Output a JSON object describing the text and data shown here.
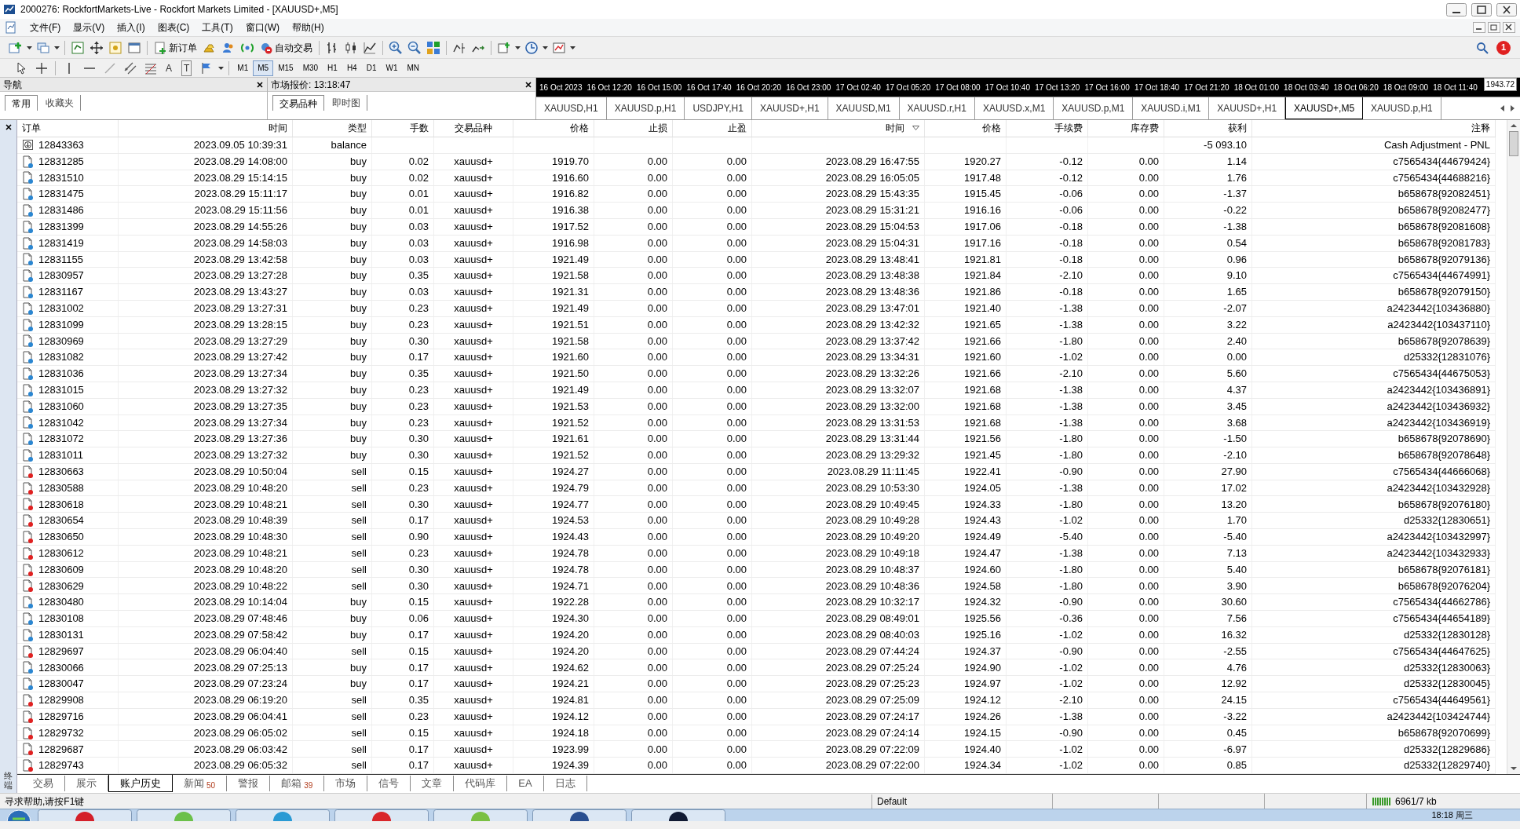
{
  "window": {
    "title": "2000276: RockfortMarkets-Live - Rockfort Markets Limited - [XAUUSD+,M5]"
  },
  "menu": [
    "文件(F)",
    "显示(V)",
    "插入(I)",
    "图表(C)",
    "工具(T)",
    "窗口(W)",
    "帮助(H)"
  ],
  "toolbar": {
    "new_order": "新订单",
    "auto_trading": "自动交易",
    "notifications": "1"
  },
  "drawing_toolbar": {
    "text_tool": "A",
    "text_label_tool": "T",
    "timeframes": [
      {
        "label": "M1",
        "selected": false
      },
      {
        "label": "M5",
        "selected": true
      },
      {
        "label": "M15",
        "selected": false
      },
      {
        "label": "M30",
        "selected": false
      },
      {
        "label": "H1",
        "selected": false
      },
      {
        "label": "H4",
        "selected": false
      },
      {
        "label": "D1",
        "selected": false
      },
      {
        "label": "W1",
        "selected": false
      },
      {
        "label": "MN",
        "selected": false
      }
    ]
  },
  "navigator": {
    "title": "导航",
    "tabs": [
      {
        "label": "常用",
        "selected": true
      },
      {
        "label": "收藏夹",
        "selected": false
      }
    ]
  },
  "market_watch": {
    "title": "市场报价: 13:18:47",
    "tabs": [
      {
        "label": "交易品种",
        "selected": true
      },
      {
        "label": "即时图",
        "selected": false
      }
    ]
  },
  "chart": {
    "time_labels": [
      "16 Oct 2023",
      "16 Oct 12:20",
      "16 Oct 15:00",
      "16 Oct 17:40",
      "16 Oct 20:20",
      "16 Oct 23:00",
      "17 Oct 02:40",
      "17 Oct 05:20",
      "17 Oct 08:00",
      "17 Oct 10:40",
      "17 Oct 13:20",
      "17 Oct 16:00",
      "17 Oct 18:40",
      "17 Oct 21:20",
      "18 Oct 01:00",
      "18 Oct 03:40",
      "18 Oct 06:20",
      "18 Oct 09:00",
      "18 Oct 11:40"
    ],
    "price_label": "1943.72",
    "tabs": [
      {
        "label": "XAUUSD,H1",
        "selected": false
      },
      {
        "label": "XAUUSD.p,H1",
        "selected": false
      },
      {
        "label": "USDJPY,H1",
        "selected": false
      },
      {
        "label": "XAUUSD+,H1",
        "selected": false
      },
      {
        "label": "XAUUSD,M1",
        "selected": false
      },
      {
        "label": "XAUUSD.r,H1",
        "selected": false
      },
      {
        "label": "XAUUSD.x,M1",
        "selected": false
      },
      {
        "label": "XAUUSD.p,M1",
        "selected": false
      },
      {
        "label": "XAUUSD.i,M1",
        "selected": false
      },
      {
        "label": "XAUUSD+,H1",
        "selected": false
      },
      {
        "label": "XAUUSD+,M5",
        "selected": true
      },
      {
        "label": "XAUUSD.p,H1",
        "selected": false
      }
    ]
  },
  "terminal": {
    "title": "终端",
    "columns": [
      {
        "label": "订单",
        "sorted": false
      },
      {
        "label": "时间",
        "sorted": false
      },
      {
        "label": "类型",
        "sorted": false
      },
      {
        "label": "手数",
        "sorted": false
      },
      {
        "label": "交易品种",
        "sorted": false
      },
      {
        "label": "价格",
        "sorted": false
      },
      {
        "label": "止损",
        "sorted": false
      },
      {
        "label": "止盈",
        "sorted": false
      },
      {
        "label": "时间",
        "sorted": true
      },
      {
        "label": "价格",
        "sorted": false
      },
      {
        "label": "手续费",
        "sorted": false
      },
      {
        "label": "库存费",
        "sorted": false
      },
      {
        "label": "获利",
        "sorted": false
      },
      {
        "label": "注释",
        "sorted": false
      }
    ],
    "rows": [
      {
        "kind": "balance",
        "cells": [
          "12843363",
          "2023.09.05 10:39:31",
          "balance",
          null,
          null,
          null,
          null,
          null,
          null,
          null,
          null,
          null,
          "-5 093.10",
          "Cash Adjustment - PNL"
        ]
      },
      {
        "kind": "buy",
        "cells": [
          "12831285",
          "2023.08.29 14:08:00",
          "buy",
          "0.02",
          "xauusd+",
          "1919.70",
          "0.00",
          "0.00",
          "2023.08.29 16:47:55",
          "1920.27",
          "-0.12",
          "0.00",
          "1.14",
          "c7565434{44679424}"
        ]
      },
      {
        "kind": "buy",
        "cells": [
          "12831510",
          "2023.08.29 15:14:15",
          "buy",
          "0.02",
          "xauusd+",
          "1916.60",
          "0.00",
          "0.00",
          "2023.08.29 16:05:05",
          "1917.48",
          "-0.12",
          "0.00",
          "1.76",
          "c7565434{44688216}"
        ]
      },
      {
        "kind": "buy",
        "cells": [
          "12831475",
          "2023.08.29 15:11:17",
          "buy",
          "0.01",
          "xauusd+",
          "1916.82",
          "0.00",
          "0.00",
          "2023.08.29 15:43:35",
          "1915.45",
          "-0.06",
          "0.00",
          "-1.37",
          "b658678{92082451}"
        ]
      },
      {
        "kind": "buy",
        "cells": [
          "12831486",
          "2023.08.29 15:11:56",
          "buy",
          "0.01",
          "xauusd+",
          "1916.38",
          "0.00",
          "0.00",
          "2023.08.29 15:31:21",
          "1916.16",
          "-0.06",
          "0.00",
          "-0.22",
          "b658678{92082477}"
        ]
      },
      {
        "kind": "buy",
        "cells": [
          "12831399",
          "2023.08.29 14:55:26",
          "buy",
          "0.03",
          "xauusd+",
          "1917.52",
          "0.00",
          "0.00",
          "2023.08.29 15:04:53",
          "1917.06",
          "-0.18",
          "0.00",
          "-1.38",
          "b658678{92081608}"
        ]
      },
      {
        "kind": "buy",
        "cells": [
          "12831419",
          "2023.08.29 14:58:03",
          "buy",
          "0.03",
          "xauusd+",
          "1916.98",
          "0.00",
          "0.00",
          "2023.08.29 15:04:31",
          "1917.16",
          "-0.18",
          "0.00",
          "0.54",
          "b658678{92081783}"
        ]
      },
      {
        "kind": "buy",
        "cells": [
          "12831155",
          "2023.08.29 13:42:58",
          "buy",
          "0.03",
          "xauusd+",
          "1921.49",
          "0.00",
          "0.00",
          "2023.08.29 13:48:41",
          "1921.81",
          "-0.18",
          "0.00",
          "0.96",
          "b658678{92079136}"
        ]
      },
      {
        "kind": "buy",
        "cells": [
          "12830957",
          "2023.08.29 13:27:28",
          "buy",
          "0.35",
          "xauusd+",
          "1921.58",
          "0.00",
          "0.00",
          "2023.08.29 13:48:38",
          "1921.84",
          "-2.10",
          "0.00",
          "9.10",
          "c7565434{44674991}"
        ]
      },
      {
        "kind": "buy",
        "cells": [
          "12831167",
          "2023.08.29 13:43:27",
          "buy",
          "0.03",
          "xauusd+",
          "1921.31",
          "0.00",
          "0.00",
          "2023.08.29 13:48:36",
          "1921.86",
          "-0.18",
          "0.00",
          "1.65",
          "b658678{92079150}"
        ]
      },
      {
        "kind": "buy",
        "cells": [
          "12831002",
          "2023.08.29 13:27:31",
          "buy",
          "0.23",
          "xauusd+",
          "1921.49",
          "0.00",
          "0.00",
          "2023.08.29 13:47:01",
          "1921.40",
          "-1.38",
          "0.00",
          "-2.07",
          "a2423442{103436880}"
        ]
      },
      {
        "kind": "buy",
        "cells": [
          "12831099",
          "2023.08.29 13:28:15",
          "buy",
          "0.23",
          "xauusd+",
          "1921.51",
          "0.00",
          "0.00",
          "2023.08.29 13:42:32",
          "1921.65",
          "-1.38",
          "0.00",
          "3.22",
          "a2423442{103437110}"
        ]
      },
      {
        "kind": "buy",
        "cells": [
          "12830969",
          "2023.08.29 13:27:29",
          "buy",
          "0.30",
          "xauusd+",
          "1921.58",
          "0.00",
          "0.00",
          "2023.08.29 13:37:42",
          "1921.66",
          "-1.80",
          "0.00",
          "2.40",
          "b658678{92078639}"
        ]
      },
      {
        "kind": "buy",
        "cells": [
          "12831082",
          "2023.08.29 13:27:42",
          "buy",
          "0.17",
          "xauusd+",
          "1921.60",
          "0.00",
          "0.00",
          "2023.08.29 13:34:31",
          "1921.60",
          "-1.02",
          "0.00",
          "0.00",
          "d25332{12831076}"
        ]
      },
      {
        "kind": "buy",
        "cells": [
          "12831036",
          "2023.08.29 13:27:34",
          "buy",
          "0.35",
          "xauusd+",
          "1921.50",
          "0.00",
          "0.00",
          "2023.08.29 13:32:26",
          "1921.66",
          "-2.10",
          "0.00",
          "5.60",
          "c7565434{44675053}"
        ]
      },
      {
        "kind": "buy",
        "cells": [
          "12831015",
          "2023.08.29 13:27:32",
          "buy",
          "0.23",
          "xauusd+",
          "1921.49",
          "0.00",
          "0.00",
          "2023.08.29 13:32:07",
          "1921.68",
          "-1.38",
          "0.00",
          "4.37",
          "a2423442{103436891}"
        ]
      },
      {
        "kind": "buy",
        "cells": [
          "12831060",
          "2023.08.29 13:27:35",
          "buy",
          "0.23",
          "xauusd+",
          "1921.53",
          "0.00",
          "0.00",
          "2023.08.29 13:32:00",
          "1921.68",
          "-1.38",
          "0.00",
          "3.45",
          "a2423442{103436932}"
        ]
      },
      {
        "kind": "buy",
        "cells": [
          "12831042",
          "2023.08.29 13:27:34",
          "buy",
          "0.23",
          "xauusd+",
          "1921.52",
          "0.00",
          "0.00",
          "2023.08.29 13:31:53",
          "1921.68",
          "-1.38",
          "0.00",
          "3.68",
          "a2423442{103436919}"
        ]
      },
      {
        "kind": "buy",
        "cells": [
          "12831072",
          "2023.08.29 13:27:36",
          "buy",
          "0.30",
          "xauusd+",
          "1921.61",
          "0.00",
          "0.00",
          "2023.08.29 13:31:44",
          "1921.56",
          "-1.80",
          "0.00",
          "-1.50",
          "b658678{92078690}"
        ]
      },
      {
        "kind": "buy",
        "cells": [
          "12831011",
          "2023.08.29 13:27:32",
          "buy",
          "0.30",
          "xauusd+",
          "1921.52",
          "0.00",
          "0.00",
          "2023.08.29 13:29:32",
          "1921.45",
          "-1.80",
          "0.00",
          "-2.10",
          "b658678{92078648}"
        ]
      },
      {
        "kind": "sell",
        "cells": [
          "12830663",
          "2023.08.29 10:50:04",
          "sell",
          "0.15",
          "xauusd+",
          "1924.27",
          "0.00",
          "0.00",
          "2023.08.29 11:11:45",
          "1922.41",
          "-0.90",
          "0.00",
          "27.90",
          "c7565434{44666068}"
        ]
      },
      {
        "kind": "sell",
        "cells": [
          "12830588",
          "2023.08.29 10:48:20",
          "sell",
          "0.23",
          "xauusd+",
          "1924.79",
          "0.00",
          "0.00",
          "2023.08.29 10:53:30",
          "1924.05",
          "-1.38",
          "0.00",
          "17.02",
          "a2423442{103432928}"
        ]
      },
      {
        "kind": "sell",
        "cells": [
          "12830618",
          "2023.08.29 10:48:21",
          "sell",
          "0.30",
          "xauusd+",
          "1924.77",
          "0.00",
          "0.00",
          "2023.08.29 10:49:45",
          "1924.33",
          "-1.80",
          "0.00",
          "13.20",
          "b658678{92076180}"
        ]
      },
      {
        "kind": "sell",
        "cells": [
          "12830654",
          "2023.08.29 10:48:39",
          "sell",
          "0.17",
          "xauusd+",
          "1924.53",
          "0.00",
          "0.00",
          "2023.08.29 10:49:28",
          "1924.43",
          "-1.02",
          "0.00",
          "1.70",
          "d25332{12830651}"
        ]
      },
      {
        "kind": "sell",
        "cells": [
          "12830650",
          "2023.08.29 10:48:30",
          "sell",
          "0.90",
          "xauusd+",
          "1924.43",
          "0.00",
          "0.00",
          "2023.08.29 10:49:20",
          "1924.49",
          "-5.40",
          "0.00",
          "-5.40",
          "a2423442{103432997}"
        ]
      },
      {
        "kind": "sell",
        "cells": [
          "12830612",
          "2023.08.29 10:48:21",
          "sell",
          "0.23",
          "xauusd+",
          "1924.78",
          "0.00",
          "0.00",
          "2023.08.29 10:49:18",
          "1924.47",
          "-1.38",
          "0.00",
          "7.13",
          "a2423442{103432933}"
        ]
      },
      {
        "kind": "sell",
        "cells": [
          "12830609",
          "2023.08.29 10:48:20",
          "sell",
          "0.30",
          "xauusd+",
          "1924.78",
          "0.00",
          "0.00",
          "2023.08.29 10:48:37",
          "1924.60",
          "-1.80",
          "0.00",
          "5.40",
          "b658678{92076181}"
        ]
      },
      {
        "kind": "sell",
        "cells": [
          "12830629",
          "2023.08.29 10:48:22",
          "sell",
          "0.30",
          "xauusd+",
          "1924.71",
          "0.00",
          "0.00",
          "2023.08.29 10:48:36",
          "1924.58",
          "-1.80",
          "0.00",
          "3.90",
          "b658678{92076204}"
        ]
      },
      {
        "kind": "buy",
        "cells": [
          "12830480",
          "2023.08.29 10:14:04",
          "buy",
          "0.15",
          "xauusd+",
          "1922.28",
          "0.00",
          "0.00",
          "2023.08.29 10:32:17",
          "1924.32",
          "-0.90",
          "0.00",
          "30.60",
          "c7565434{44662786}"
        ]
      },
      {
        "kind": "buy",
        "cells": [
          "12830108",
          "2023.08.29 07:48:46",
          "buy",
          "0.06",
          "xauusd+",
          "1924.30",
          "0.00",
          "0.00",
          "2023.08.29 08:49:01",
          "1925.56",
          "-0.36",
          "0.00",
          "7.56",
          "c7565434{44654189}"
        ]
      },
      {
        "kind": "buy",
        "cells": [
          "12830131",
          "2023.08.29 07:58:42",
          "buy",
          "0.17",
          "xauusd+",
          "1924.20",
          "0.00",
          "0.00",
          "2023.08.29 08:40:03",
          "1925.16",
          "-1.02",
          "0.00",
          "16.32",
          "d25332{12830128}"
        ]
      },
      {
        "kind": "sell",
        "cells": [
          "12829697",
          "2023.08.29 06:04:40",
          "sell",
          "0.15",
          "xauusd+",
          "1924.20",
          "0.00",
          "0.00",
          "2023.08.29 07:44:24",
          "1924.37",
          "-0.90",
          "0.00",
          "-2.55",
          "c7565434{44647625}"
        ]
      },
      {
        "kind": "buy",
        "cells": [
          "12830066",
          "2023.08.29 07:25:13",
          "buy",
          "0.17",
          "xauusd+",
          "1924.62",
          "0.00",
          "0.00",
          "2023.08.29 07:25:24",
          "1924.90",
          "-1.02",
          "0.00",
          "4.76",
          "d25332{12830063}"
        ]
      },
      {
        "kind": "buy",
        "cells": [
          "12830047",
          "2023.08.29 07:23:24",
          "buy",
          "0.17",
          "xauusd+",
          "1924.21",
          "0.00",
          "0.00",
          "2023.08.29 07:25:23",
          "1924.97",
          "-1.02",
          "0.00",
          "12.92",
          "d25332{12830045}"
        ]
      },
      {
        "kind": "sell",
        "cells": [
          "12829908",
          "2023.08.29 06:19:20",
          "sell",
          "0.35",
          "xauusd+",
          "1924.81",
          "0.00",
          "0.00",
          "2023.08.29 07:25:09",
          "1924.12",
          "-2.10",
          "0.00",
          "24.15",
          "c7565434{44649561}"
        ]
      },
      {
        "kind": "sell",
        "cells": [
          "12829716",
          "2023.08.29 06:04:41",
          "sell",
          "0.23",
          "xauusd+",
          "1924.12",
          "0.00",
          "0.00",
          "2023.08.29 07:24:17",
          "1924.26",
          "-1.38",
          "0.00",
          "-3.22",
          "a2423442{103424744}"
        ]
      },
      {
        "kind": "sell",
        "cells": [
          "12829732",
          "2023.08.29 06:05:02",
          "sell",
          "0.15",
          "xauusd+",
          "1924.18",
          "0.00",
          "0.00",
          "2023.08.29 07:24:14",
          "1924.15",
          "-0.90",
          "0.00",
          "0.45",
          "b658678{92070699}"
        ]
      },
      {
        "kind": "sell",
        "cells": [
          "12829687",
          "2023.08.29 06:03:42",
          "sell",
          "0.17",
          "xauusd+",
          "1923.99",
          "0.00",
          "0.00",
          "2023.08.29 07:22:09",
          "1924.40",
          "-1.02",
          "0.00",
          "-6.97",
          "d25332{12829686}"
        ]
      },
      {
        "kind": "sell",
        "cells": [
          "12829743",
          "2023.08.29 06:05:32",
          "sell",
          "0.17",
          "xauusd+",
          "1924.39",
          "0.00",
          "0.00",
          "2023.08.29 07:22:00",
          "1924.34",
          "-1.02",
          "0.00",
          "0.85",
          "d25332{12829740}"
        ]
      }
    ],
    "tabs": [
      {
        "label": "交易",
        "selected": false
      },
      {
        "label": "展示",
        "selected": false
      },
      {
        "label": "账户历史",
        "selected": true
      },
      {
        "label": "新闻",
        "count": "50",
        "selected": false
      },
      {
        "label": "警报",
        "selected": false
      },
      {
        "label": "邮箱",
        "count": "39",
        "selected": false
      },
      {
        "label": "市场",
        "selected": false
      },
      {
        "label": "信号",
        "selected": false
      },
      {
        "label": "文章",
        "selected": false
      },
      {
        "label": "代码库",
        "selected": false
      },
      {
        "label": "EA",
        "selected": false
      },
      {
        "label": "日志",
        "selected": false
      }
    ]
  },
  "status_bar": {
    "help": "寻求帮助,请按F1键",
    "profile": "Default",
    "traffic": "6961/7 kb"
  },
  "taskbar": {
    "clock": "18:18 周三"
  }
}
